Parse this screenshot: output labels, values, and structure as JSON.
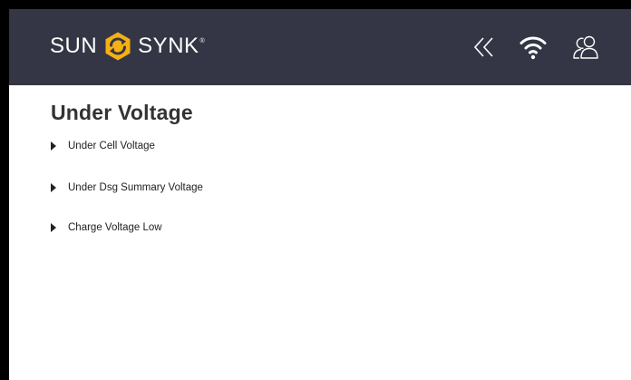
{
  "header": {
    "logo_left": "SUN",
    "logo_right": "SYNK",
    "logo_reg": "®",
    "accent_color": "#F5B014",
    "background_color": "#343645",
    "icons": [
      "chevrons-left-icon",
      "wifi-icon",
      "users-icon"
    ]
  },
  "page": {
    "title": "Under Voltage"
  },
  "items": [
    {
      "label": "Under Cell Voltage",
      "icon": "caret-right-icon"
    },
    {
      "label": "Under Dsg Summary Voltage",
      "icon": "caret-right-icon"
    },
    {
      "label": "Charge Voltage Low",
      "icon": "caret-right-icon"
    }
  ]
}
